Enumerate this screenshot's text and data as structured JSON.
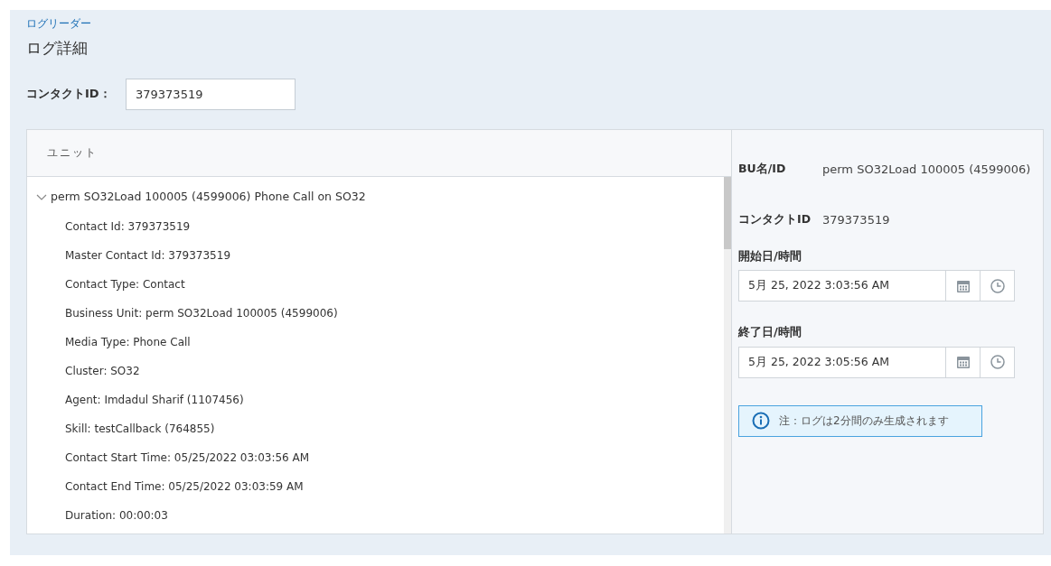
{
  "breadcrumb": "ログリーダー",
  "page_title": "ログ詳細",
  "contact_field": {
    "label": "コンタクトID：",
    "value": "379373519"
  },
  "unit_panel": {
    "header": "ユニット",
    "tree": [
      {
        "label": "perm SO32Load 100005 (4599006) Phone Call on SO32",
        "expanded": true,
        "children": [
          {
            "label": "Contact Id: 379373519"
          },
          {
            "label": "Master Contact Id: 379373519"
          },
          {
            "label": "Contact Type: Contact"
          },
          {
            "label": "Business Unit: perm SO32Load 100005 (4599006)"
          },
          {
            "label": "Media Type: Phone Call"
          },
          {
            "label": "Cluster: SO32"
          },
          {
            "label": "Agent: Imdadul Sharif (1107456)"
          },
          {
            "label": "Skill: testCallback (764855)"
          },
          {
            "label": "Contact Start Time: 05/25/2022 03:03:56 AM"
          },
          {
            "label": "Contact End Time: 05/25/2022 03:03:59 AM"
          },
          {
            "label": "Duration: 00:00:03"
          }
        ]
      }
    ]
  },
  "details": {
    "info": [
      {
        "label": "BU名/ID",
        "value": "perm SO32Load 100005 (4599006)"
      },
      {
        "label": "コンタクトID",
        "value": "379373519"
      }
    ],
    "datetimes": [
      {
        "label": "開始日/時間",
        "value": "5月 25, 2022 3:03:56 AM"
      },
      {
        "label": "終了日/時間",
        "value": "5月 25, 2022 3:05:56 AM"
      }
    ],
    "note": "注：ログは2分間のみ生成されます"
  }
}
